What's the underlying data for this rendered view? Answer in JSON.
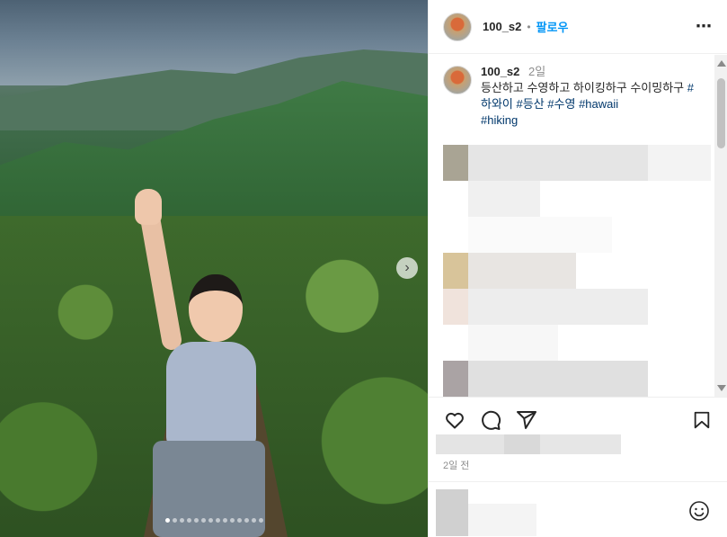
{
  "post": {
    "username": "100_s2",
    "separator": "•",
    "follow_label": "팔로우",
    "more_icon": "more-icon",
    "caption": {
      "username": "100_s2",
      "time": "2일",
      "text": "등산하고 수영하고 하이킹하구 수이밍하구",
      "hashtags": [
        "#하와이",
        "#등산",
        "#수영",
        "#hawaii",
        "#hiking"
      ]
    },
    "time_ago": "2일 전",
    "carousel": {
      "dot_count": 14,
      "active_index": 0
    }
  },
  "icons": {
    "like": "heart-icon",
    "comment": "comment-icon",
    "share": "share-icon",
    "save": "bookmark-icon",
    "emoji": "emoji-icon",
    "next": "chevron-right-icon"
  },
  "colors": {
    "follow": "#0095f6",
    "hashtag": "#00376b",
    "muted": "#8e8e8e"
  }
}
